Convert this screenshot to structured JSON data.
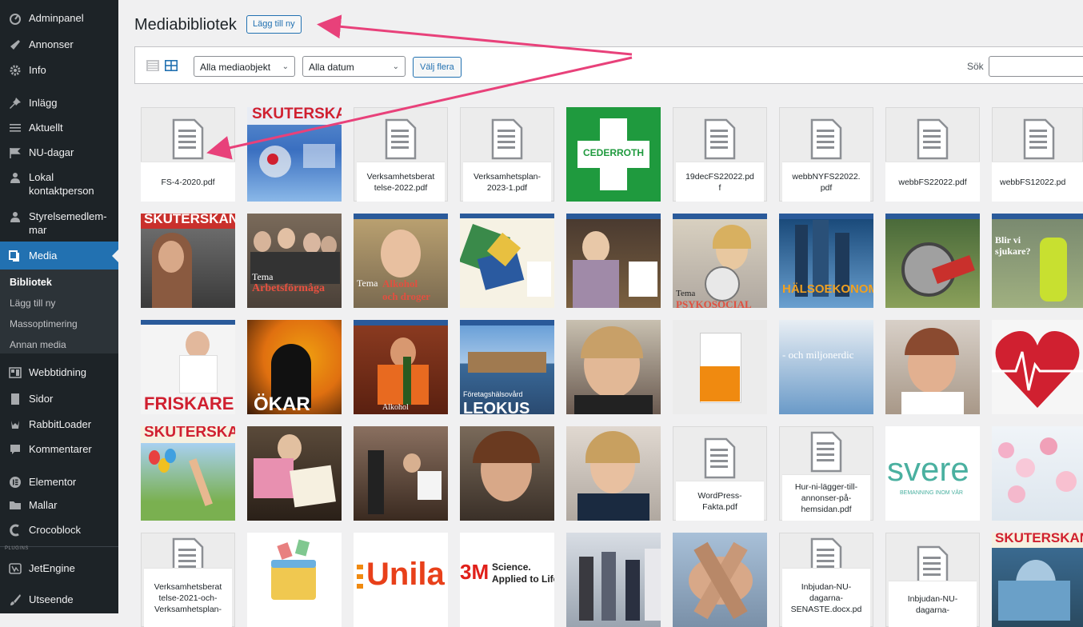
{
  "sidebar": {
    "items": [
      {
        "label": "Adminpanel",
        "icon": "dashboard-icon"
      },
      {
        "label": "Annonser",
        "icon": "megaphone-icon"
      },
      {
        "label": "Info",
        "icon": "gear-icon"
      },
      {
        "label": "Inlägg",
        "icon": "pin-icon"
      },
      {
        "label": "Aktuellt",
        "icon": "list-icon"
      },
      {
        "label": "NU-dagar",
        "icon": "flag-icon"
      },
      {
        "label": "Lokal\nkontaktperson",
        "icon": "user-icon"
      },
      {
        "label": "Styrelsemedlem-\nmar",
        "icon": "user-icon"
      },
      {
        "label": "Media",
        "icon": "media-icon",
        "active": true
      },
      {
        "label": "Webbtidning",
        "icon": "grid-icon"
      },
      {
        "label": "Sidor",
        "icon": "page-icon"
      },
      {
        "label": "RabbitLoader",
        "icon": "rabbit-icon"
      },
      {
        "label": "Kommentarer",
        "icon": "comment-icon"
      },
      {
        "label": "Elementor",
        "icon": "elementor-icon"
      },
      {
        "label": "Mallar",
        "icon": "folder-icon"
      },
      {
        "label": "Crocoblock",
        "icon": "crocoblock-icon"
      },
      {
        "label": "JetEngine",
        "icon": "jetengine-icon"
      },
      {
        "label": "Utseende",
        "icon": "brush-icon"
      }
    ],
    "submenu": [
      "Bibliotek",
      "Lägg till ny",
      "Massoptimering",
      "Annan media"
    ],
    "plugins_label": "PLUGINS"
  },
  "header": {
    "title": "Mediabibliotek",
    "add_new": "Lägg till ny"
  },
  "toolbar": {
    "filter_type": "Alla mediaobjekt",
    "filter_date": "Alla datum",
    "bulk_select": "Välj flera",
    "search_label": "Sök",
    "search_value": ""
  },
  "grid": {
    "rows": [
      [
        {
          "kind": "doc",
          "name": "FS-4-2020.pdf"
        },
        {
          "kind": "img",
          "caption": "SKUTERSKAN"
        },
        {
          "kind": "doc",
          "name": "Verksamhetsberat\ntelse-2022.pdf"
        },
        {
          "kind": "doc",
          "name": "Verksamhetsplan-\n2023-1.pdf"
        },
        {
          "kind": "img",
          "caption": "CEDERROTH"
        },
        {
          "kind": "doc",
          "name": "19decFS22022.pd\nf"
        },
        {
          "kind": "doc",
          "name": "webbNYFS22022.\npdf"
        },
        {
          "kind": "doc",
          "name": "webbFS22022.pdf"
        },
        {
          "kind": "doc",
          "name": "webbFS12022.pd"
        }
      ],
      [
        {
          "kind": "img",
          "caption": "SKUTERSKAN"
        },
        {
          "kind": "img",
          "caption": "Tema Arbetsförmåga"
        },
        {
          "kind": "img",
          "caption": "Tema Alkohol och droger"
        },
        {
          "kind": "img",
          "caption": ""
        },
        {
          "kind": "img",
          "caption": ""
        },
        {
          "kind": "img",
          "caption": "Tema PSYKOSOCIAL"
        },
        {
          "kind": "img",
          "caption": "HÄLSOEKONOMI"
        },
        {
          "kind": "img",
          "caption": ""
        },
        {
          "kind": "img",
          "caption": "Blir vi sjukare?"
        }
      ],
      [
        {
          "kind": "img",
          "caption": "FRISKARE"
        },
        {
          "kind": "img",
          "caption": "ÖKAR"
        },
        {
          "kind": "img",
          "caption": "Tema Alkohol"
        },
        {
          "kind": "img",
          "caption": "Företagshälsovård LEOKUS"
        },
        {
          "kind": "img",
          "caption": ""
        },
        {
          "kind": "img",
          "caption": ""
        },
        {
          "kind": "img",
          "caption": "- och miljonerdic"
        },
        {
          "kind": "img",
          "caption": ""
        },
        {
          "kind": "img",
          "caption": ""
        }
      ],
      [
        {
          "kind": "img",
          "caption": "SKUTERSKAN"
        },
        {
          "kind": "img",
          "caption": ""
        },
        {
          "kind": "img",
          "caption": ""
        },
        {
          "kind": "img",
          "caption": ""
        },
        {
          "kind": "img",
          "caption": ""
        },
        {
          "kind": "doc",
          "name": "WordPress-\nFakta.pdf"
        },
        {
          "kind": "doc",
          "name": "Hur-ni-lägger-till-\nannonser-på-\nhemsidan.pdf"
        },
        {
          "kind": "img",
          "caption": "svere"
        },
        {
          "kind": "img",
          "caption": ""
        }
      ],
      [
        {
          "kind": "doc",
          "name": "Verksamhetsberat\ntelse-2021-och-\nVerksamhetsplan-"
        },
        {
          "kind": "img",
          "caption": ""
        },
        {
          "kind": "img",
          "caption": "Unila"
        },
        {
          "kind": "img",
          "caption": "3M Science. Applied to Life"
        },
        {
          "kind": "img",
          "caption": ""
        },
        {
          "kind": "img",
          "caption": ""
        },
        {
          "kind": "doc",
          "name": "Inbjudan-NU-\ndagarna-\nSENASTE.docx.pd"
        },
        {
          "kind": "doc",
          "name": "Inbjudan-NU-\ndagarna-"
        },
        {
          "kind": "img",
          "caption": "SKUTERSKAN"
        }
      ]
    ],
    "captions": {
      "skuterskan": "SKUTERSKAN",
      "cederroth": "CEDERROTH",
      "tema": "Tema",
      "arbetsformaga": "Arbetsförmåga",
      "alkohol": "Alkohol",
      "och_droger": "och droger",
      "psykosocial": "PSYKOSOCIAL",
      "halsoekonomi": "HÄLSOEKONOMI",
      "blir_vi": "Blir vi",
      "sjukare": "sjukare?",
      "friskare": "FRISKARE",
      "okar": "ÖKAR",
      "leokus": "LEOKUS",
      "foretagshalsovard": "Företagshälsovård",
      "miljoner": "- och miljonerdic",
      "svere": "svere",
      "bemanning": "BEMANNING INOM VÅR",
      "unila": "Unila",
      "science": "Science.",
      "applied": "Applied to Life",
      "three_m": "3M"
    }
  },
  "colors": {
    "sidebar_bg": "#1d2327",
    "active_bg": "#2271b1",
    "accent": "#2271b1",
    "annotation_arrow": "#e8417a"
  }
}
